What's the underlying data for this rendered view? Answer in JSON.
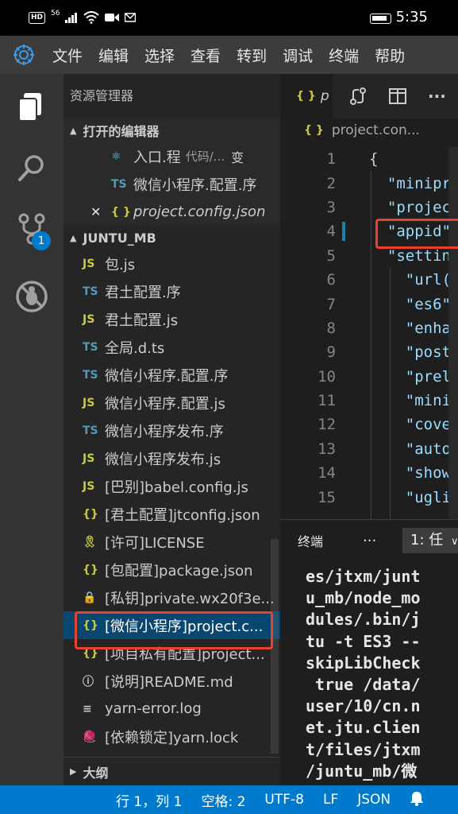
{
  "phone": {
    "left_indicators": "HD",
    "signal": "56",
    "time": "5:35"
  },
  "menu": {
    "items": [
      "文件",
      "编辑",
      "选择",
      "查看",
      "转到",
      "调试",
      "终端",
      "帮助"
    ]
  },
  "activity": {
    "scm_badge": "1"
  },
  "sidebar": {
    "title": "资源管理器",
    "open_editors_header": "打开的编辑器",
    "open_editors": [
      {
        "icon": "react-icon",
        "name": "入口.程",
        "desc": "代码/...",
        "modified": "变"
      },
      {
        "icon": "ts-icon",
        "name": "微信小程序.配置.序",
        "desc": "",
        "modified": ""
      },
      {
        "icon": "json-icon",
        "name": "project.config.json",
        "desc": "",
        "modified": "",
        "active": true
      }
    ],
    "project_header": "JUNTU_MB",
    "files": [
      {
        "icon": "JS",
        "kind": "js",
        "name": "包.js"
      },
      {
        "icon": "TS",
        "kind": "ts",
        "name": "君土配置.序"
      },
      {
        "icon": "JS",
        "kind": "js",
        "name": "君土配置.js"
      },
      {
        "icon": "TS",
        "kind": "ts",
        "name": "全局.d.ts"
      },
      {
        "icon": "TS",
        "kind": "ts",
        "name": "微信小程序.配置.序"
      },
      {
        "icon": "JS",
        "kind": "js",
        "name": "微信小程序.配置.js"
      },
      {
        "icon": "TS",
        "kind": "ts",
        "name": "微信小程序发布.序"
      },
      {
        "icon": "JS",
        "kind": "js",
        "name": "微信小程序发布.js"
      },
      {
        "icon": "JS",
        "kind": "js",
        "name": "[巴别]babel.config.js"
      },
      {
        "icon": "{}",
        "kind": "json",
        "name": "[君土配置]jtconfig.json"
      },
      {
        "icon": "🎗",
        "kind": "lic",
        "name": "[许可]LICENSE"
      },
      {
        "icon": "{}",
        "kind": "json",
        "name": "[包配置]package.json"
      },
      {
        "icon": "🔒",
        "kind": "lock",
        "name": "[私钥]private.wx20f3e..."
      },
      {
        "icon": "{}",
        "kind": "json",
        "name": "[微信小程序]project.c...",
        "selected": true
      },
      {
        "icon": "{}",
        "kind": "json",
        "name": "[项目私有配置]project..."
      },
      {
        "icon": "ⓘ",
        "kind": "info",
        "name": "[说明]README.md"
      },
      {
        "icon": "≡",
        "kind": "log",
        "name": "yarn-error.log"
      },
      {
        "icon": "🧶",
        "kind": "yarn",
        "name": "[依赖锁定]yarn.lock"
      }
    ],
    "outline_header": "大纲"
  },
  "editor": {
    "tab_label": "p",
    "breadcrumb": "project.con...",
    "lines": [
      {
        "n": "1",
        "text": "{"
      },
      {
        "n": "2",
        "text": "  \"minipr"
      },
      {
        "n": "3",
        "text": "  \"projec"
      },
      {
        "n": "4",
        "text": "  \"appid\""
      },
      {
        "n": "5",
        "text": "  \"settin"
      },
      {
        "n": "6",
        "text": "    \"url("
      },
      {
        "n": "7",
        "text": "    \"es6\""
      },
      {
        "n": "8",
        "text": "    \"enha"
      },
      {
        "n": "9",
        "text": "    \"post"
      },
      {
        "n": "10",
        "text": "    \"prel"
      },
      {
        "n": "11",
        "text": "    \"mini"
      },
      {
        "n": "12",
        "text": "    \"cove"
      },
      {
        "n": "13",
        "text": "    \"auto"
      },
      {
        "n": "14",
        "text": "    \"show"
      },
      {
        "n": "15",
        "text": "    \"ugli"
      }
    ]
  },
  "panel": {
    "title": "终端",
    "dots": "···",
    "selector": "1: 任",
    "terminal_text": "es/jtxm/junt\nu_mb/node_mo\ndules/.bin/j\ntu -t ES3 --\nskipLibCheck\n true /data/\nuser/10/cn.n\net.jtu.clien\nt/files/jtxm\n/juntu_mb/微"
  },
  "statusbar": {
    "position": "行 1，列 1",
    "spaces": "空格: 2",
    "encoding": "UTF-8",
    "eol": "LF",
    "language": "JSON"
  },
  "colors": {
    "accent": "#007acc",
    "highlight": "#e8422f",
    "selected": "#094771"
  }
}
